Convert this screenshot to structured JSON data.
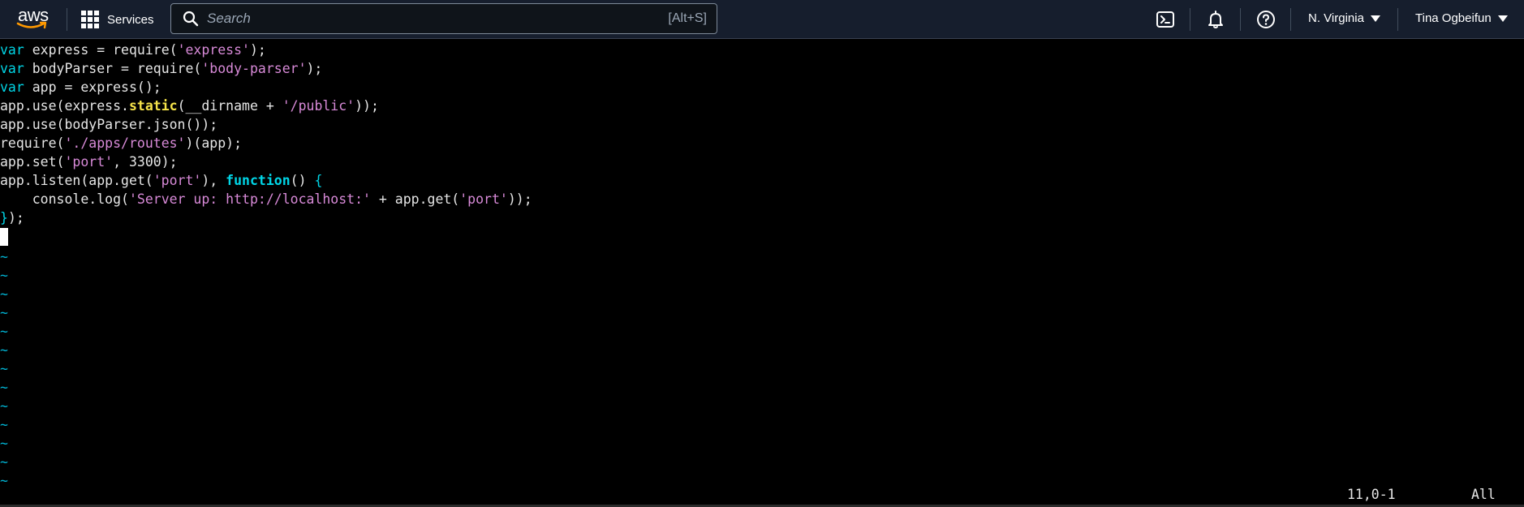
{
  "navbar": {
    "logo_text": "aws",
    "services_label": "Services",
    "search_placeholder": "Search",
    "search_shortcut": "[Alt+S]",
    "region": "N. Virginia",
    "user": "Tina Ogbeifun",
    "icons": [
      "cloudshell-icon",
      "bell-icon",
      "help-icon"
    ]
  },
  "editor": {
    "lines": [
      [
        {
          "t": "var",
          "c": "kw"
        },
        {
          "t": " express = require("
        },
        {
          "t": "'express'",
          "c": "str"
        },
        {
          "t": ");"
        }
      ],
      [
        {
          "t": "var",
          "c": "kw"
        },
        {
          "t": " bodyParser = require("
        },
        {
          "t": "'body-parser'",
          "c": "str"
        },
        {
          "t": ");"
        }
      ],
      [
        {
          "t": "var",
          "c": "kw"
        },
        {
          "t": " app = express();"
        }
      ],
      [
        {
          "t": "app.use(express."
        },
        {
          "t": "static",
          "c": "yel"
        },
        {
          "t": "(__dirname + "
        },
        {
          "t": "'/public'",
          "c": "str"
        },
        {
          "t": "));"
        }
      ],
      [
        {
          "t": "app.use(bodyParser.json());"
        }
      ],
      [
        {
          "t": "require("
        },
        {
          "t": "'./apps/routes'",
          "c": "str"
        },
        {
          "t": ")(app);"
        }
      ],
      [
        {
          "t": "app.set("
        },
        {
          "t": "'port'",
          "c": "str"
        },
        {
          "t": ", 3300);"
        }
      ],
      [
        {
          "t": "app.listen(app.get("
        },
        {
          "t": "'port'",
          "c": "str"
        },
        {
          "t": "), "
        },
        {
          "t": "function",
          "c": "fn"
        },
        {
          "t": "() "
        },
        {
          "t": "{",
          "c": "kw"
        }
      ],
      [
        {
          "t": "    console.log("
        },
        {
          "t": "'Server up: http://localhost:'",
          "c": "str"
        },
        {
          "t": " + app.get("
        },
        {
          "t": "'port'",
          "c": "str"
        },
        {
          "t": "));"
        }
      ],
      [
        {
          "t": "}",
          "c": "kw"
        },
        {
          "t": ");"
        }
      ]
    ],
    "empty_marker": "~",
    "status_position": "11,0-1",
    "status_scroll": "All",
    "colors": {
      "keyword": "#00d5e6",
      "string": "#d88ad8",
      "builtin": "#f5e34a",
      "tilde": "#00b4d4",
      "navbar_bg": "#161e2d"
    }
  }
}
